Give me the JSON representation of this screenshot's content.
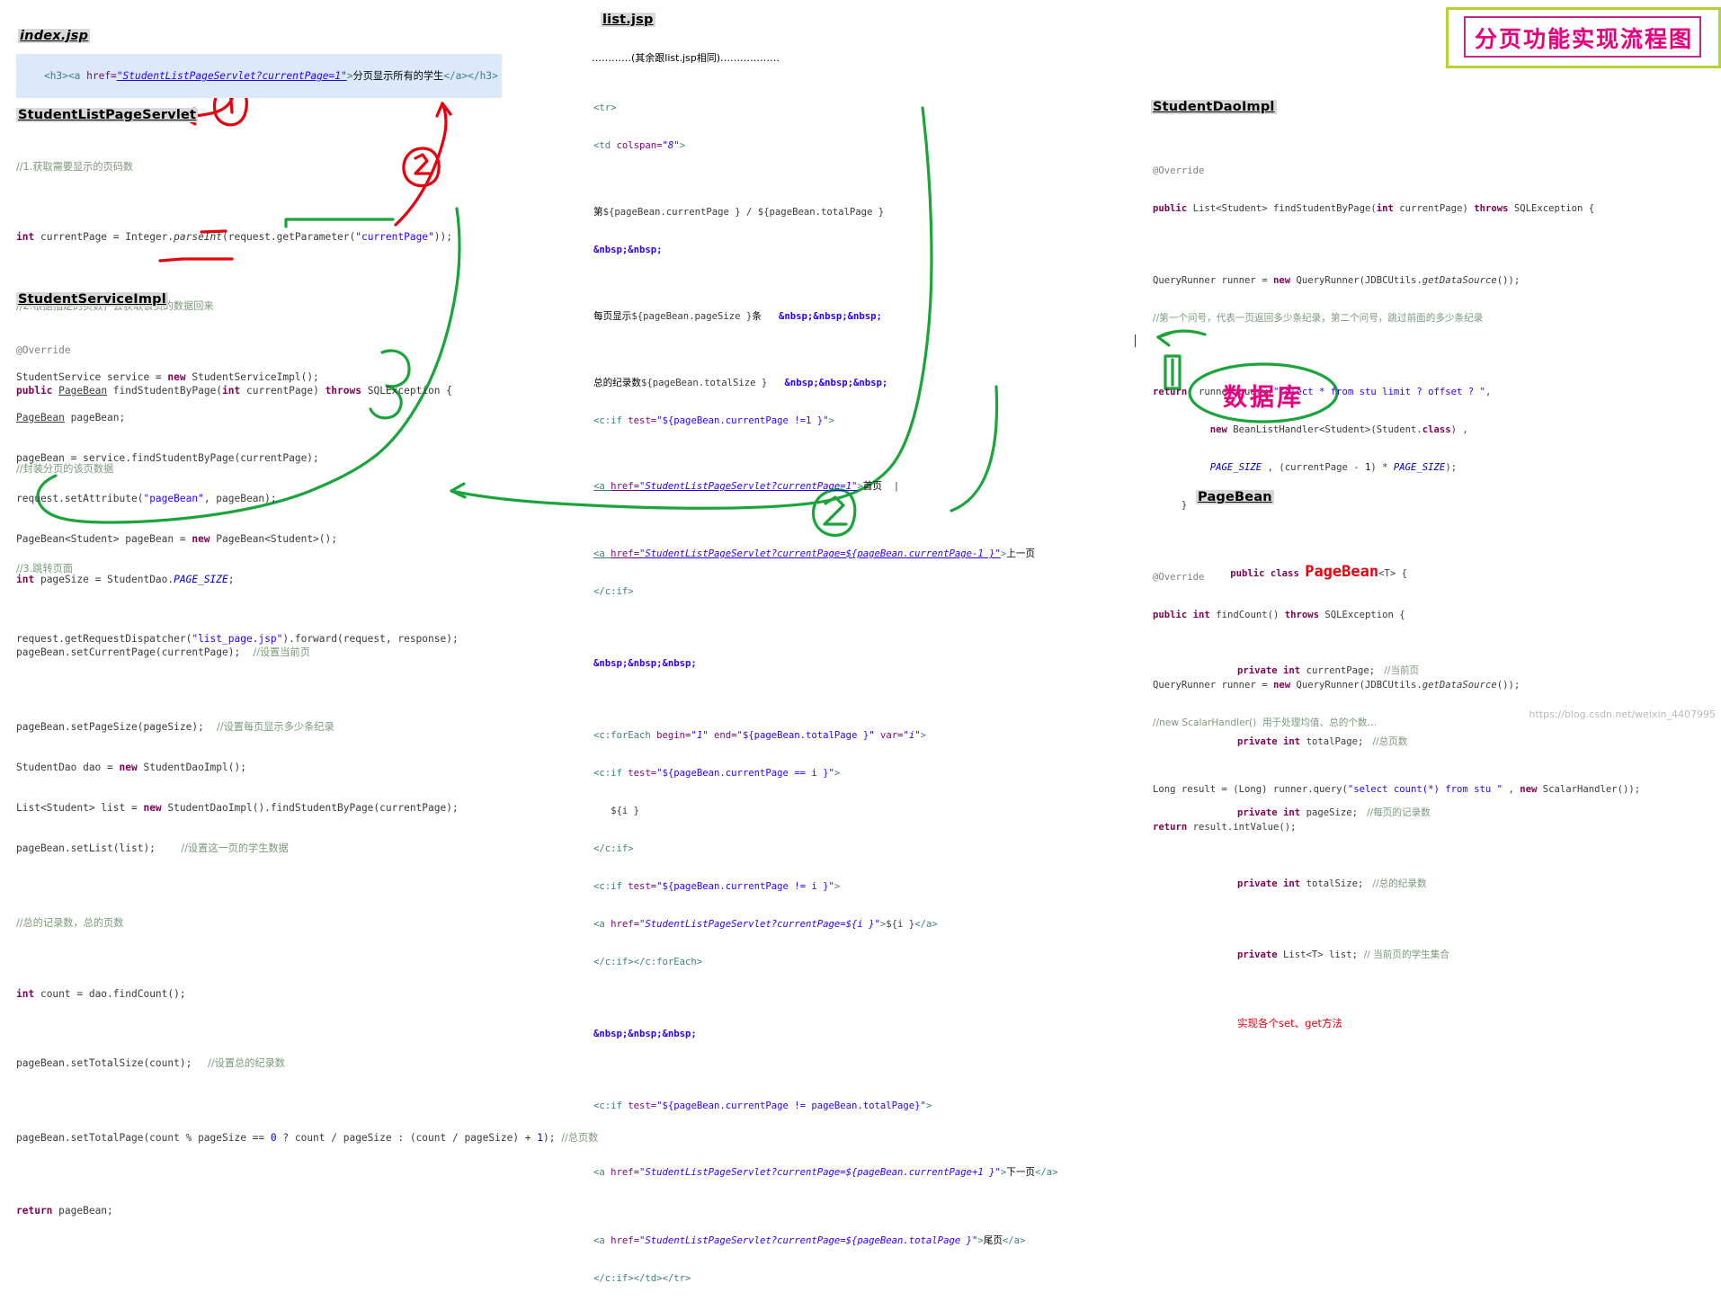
{
  "title_banner": {
    "text": "分页功能实现流程图",
    "border_outer_color": "#b5d333",
    "border_inner_color": "#c02a8e",
    "text_color": "#e6007e"
  },
  "watermark": "https://blog.csdn.net/weixin_4407995",
  "annotations": {
    "database_label": "数据库",
    "marker_1": "1",
    "marker_2": "2",
    "marker_3": "3",
    "marker_4": "2",
    "red_color": "#e8000d",
    "green_color": "#1aa53a",
    "pink_color": "#e6007e"
  },
  "sections": {
    "index_jsp": {
      "heading": "index.jsp",
      "lines": [
        "<h3><a href=\"StudentListPageServlet?currentPage=1\">分页显示所有的学生</a></h3>"
      ]
    },
    "student_list_page_servlet": {
      "heading": "StudentListPageServlet",
      "lines": [
        "//1.获取需要显示的页码数",
        "int currentPage = Integer.parseInt(request.getParameter(\"currentPage\"));",
        "//2.根据指定的页数，去获取该页的数据回来",
        "StudentService service = new StudentServiceImpl();",
        "PageBean pageBean;",
        "pageBean = service.findStudentByPage(currentPage);",
        "request.setAttribute(\"pageBean\", pageBean);",
        "//3.跳转页面",
        "request.getRequestDispatcher(\"list_page.jsp\").forward(request, response);"
      ]
    },
    "student_service_impl": {
      "heading": "StudentServiceImpl",
      "lines": [
        "@Override",
        "public PageBean findStudentByPage(int currentPage) throws SQLException {",
        "//封装分页的该页数据",
        "PageBean<Student> pageBean = new PageBean<Student>();",
        "int pageSize = StudentDao.PAGE_SIZE;",
        "pageBean.setCurrentPage(currentPage);    //设置当前页",
        "pageBean.setPageSize(pageSize);    //设置每页显示多少条纪录",
        "StudentDao dao = new StudentDaoImpl();",
        "List<Student> list = new StudentDaoImpl().findStudentByPage(currentPage);",
        "pageBean.setList(list);        //设置这一页的学生数据",
        "//总的记录数，总的页数",
        "int count = dao.findCount();",
        "pageBean.setTotalSize(count);     //设置总的纪录数",
        "pageBean.setTotalPage(count % pageSize == 0 ? count / pageSize : (count / pageSize) + 1); //总页数",
        "return pageBean;"
      ]
    },
    "list_jsp": {
      "heading": "list.jsp",
      "ellipsis_line": "…………(其余跟list.jsp相同)………………",
      "lines": [
        "<tr>",
        "<td colspan=\"8\">",
        "第${pageBean.currentPage } / ${pageBean.totalPage }",
        "&nbsp;&nbsp;",
        "每页显示${pageBean.pageSize }条   &nbsp;&nbsp;&nbsp;",
        "总的纪录数${pageBean.totalSize }   &nbsp;&nbsp;&nbsp;",
        "<c:if test=\"${pageBean.currentPage !=1 }\">",
        "<a href=\"StudentListPageServlet?currentPage=1\">首页  |",
        "<a href=\"StudentListPageServlet?currentPage=${pageBean.currentPage-1 }\">上一页",
        "</c:if>",
        "&nbsp;&nbsp;&nbsp;",
        "<c:forEach begin=\"1\" end=\"${pageBean.totalPage }\" var=\"i\">",
        "<c:if test=\"${pageBean.currentPage == i }\">",
        "   ${i }",
        "</c:if>",
        "<c:if test=\"${pageBean.currentPage != i }\">",
        "<a href=\"StudentListPageServlet?currentPage=${i }\">${i }</a>",
        "</c:if></c:forEach>",
        "&nbsp;&nbsp;&nbsp;",
        "<c:if test=\"${pageBean.currentPage != pageBean.totalPage}\">",
        "<a href=\"StudentListPageServlet?currentPage=${pageBean.currentPage+1 }\">下一页</a>",
        "<a href=\"StudentListPageServlet?currentPage=${pageBean.totalPage }\">尾页</a>",
        "</c:if></td></tr>"
      ]
    },
    "student_dao_impl": {
      "heading": "StudentDaoImpl",
      "lines": [
        "@Override",
        "public List<Student> findStudentByPage(int currentPage) throws SQLException {",
        "QueryRunner runner = new QueryRunner(JDBCUtils.getDataSource());",
        "//第一个问号，代表一页返回多少条纪录，第二个问号，跳过前面的多少条纪录",
        "return  runner.query(\"select * from stu limit ? offset ? \",",
        "          new BeanListHandler<Student>(Student.class) ,",
        "          PAGE_SIZE , (currentPage - 1) * PAGE_SIZE);",
        "    }",
        "@Override",
        "public int findCount() throws SQLException {",
        "QueryRunner runner = new QueryRunner(JDBCUtils.getDataSource());",
        "//new ScalarHandler()  用于处理均值、总的个数…",
        "Long result = (Long) runner.query(\"select count(*) from stu \" , new ScalarHandler());",
        "return result.intValue();"
      ]
    },
    "page_bean": {
      "heading": "PageBean",
      "class_decl": "public class PageBean<T> {",
      "class_name": "PageBean",
      "fields": [
        {
          "code": "private int currentPage;",
          "comment": "//当前页"
        },
        {
          "code": "private int totalPage;",
          "comment": "//总页数"
        },
        {
          "code": "private int pageSize;",
          "comment": "//每页的记录数"
        },
        {
          "code": "private int totalSize;",
          "comment": "//总的纪录数"
        },
        {
          "code": "private List<T> list;",
          "comment": "// 当前页的学生集合"
        }
      ],
      "footer_note": "实现各个set、get方法"
    }
  }
}
